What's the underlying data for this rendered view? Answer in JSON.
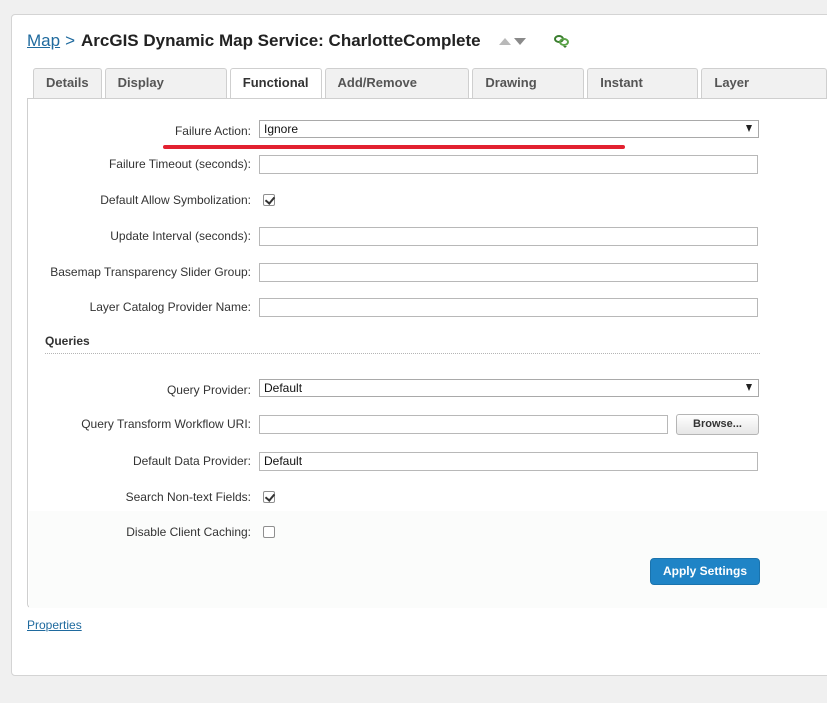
{
  "header": {
    "breadcrumb_link": "Map",
    "breadcrumb_sep": ">",
    "title": "ArcGIS Dynamic Map Service: CharlotteComplete",
    "icons": [
      "arrow-up-icon",
      "arrow-down-icon",
      "link-icon"
    ]
  },
  "tabs": [
    {
      "label": "Details",
      "active": false
    },
    {
      "label": "Display Settings",
      "active": false
    },
    {
      "label": "Functional",
      "active": true
    },
    {
      "label": "Add/Remove Layers",
      "active": false
    },
    {
      "label": "Drawing Order",
      "active": false
    },
    {
      "label": "Instant Search",
      "active": false
    },
    {
      "label": "Layer Hyperlinks",
      "active": false
    }
  ],
  "form": {
    "failure_action": {
      "label": "Failure Action:",
      "value": "Ignore"
    },
    "failure_timeout": {
      "label": "Failure Timeout (seconds):",
      "value": ""
    },
    "default_allow_symbolization": {
      "label": "Default Allow Symbolization:",
      "checked": true
    },
    "update_interval": {
      "label": "Update Interval (seconds):",
      "value": ""
    },
    "basemap_transparency": {
      "label": "Basemap Transparency Slider Group:",
      "value": ""
    },
    "layer_catalog_provider": {
      "label": "Layer Catalog Provider Name:",
      "value": ""
    }
  },
  "queries": {
    "section_title": "Queries",
    "query_provider": {
      "label": "Query Provider:",
      "value": "Default"
    },
    "query_transform_uri": {
      "label": "Query Transform Workflow URI:",
      "value": "",
      "browse_label": "Browse..."
    },
    "default_data_provider": {
      "label": "Default Data Provider:",
      "value": "Default"
    },
    "search_non_text": {
      "label": "Search Non-text Fields:",
      "checked": true
    },
    "disable_client_caching": {
      "label": "Disable Client Caching:",
      "checked": false
    }
  },
  "apply_label": "Apply Settings",
  "footer": {
    "properties_link": "Properties"
  },
  "colors": {
    "accent": "#1f84c6",
    "link": "#1f6a9e",
    "annotation": "#e22130"
  }
}
